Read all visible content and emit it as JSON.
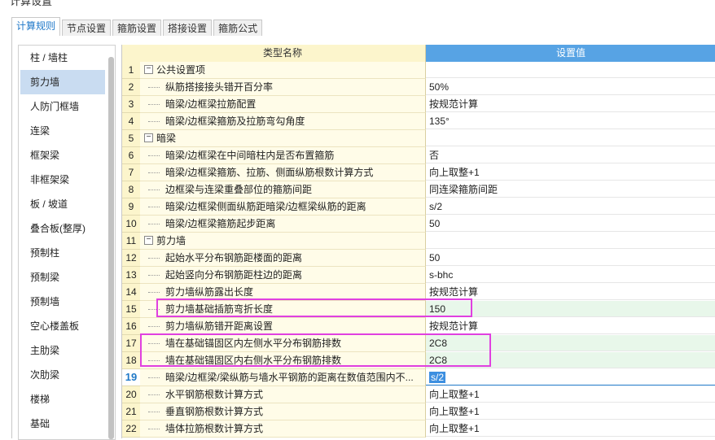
{
  "window": {
    "title": "计算设置"
  },
  "tabs": [
    {
      "label": "计算规则",
      "active": true
    },
    {
      "label": "节点设置",
      "active": false
    },
    {
      "label": "箍筋设置",
      "active": false
    },
    {
      "label": "搭接设置",
      "active": false
    },
    {
      "label": "箍筋公式",
      "active": false
    }
  ],
  "sidebar": {
    "items": [
      "柱 / 墙柱",
      "剪力墙",
      "人防门框墙",
      "连梁",
      "框架梁",
      "非框架梁",
      "板 / 坡道",
      "叠合板(整厚)",
      "预制柱",
      "预制梁",
      "预制墙",
      "空心楼盖板",
      "主肋梁",
      "次肋梁",
      "楼梯",
      "基础"
    ],
    "selected": "剪力墙"
  },
  "grid": {
    "header": {
      "name": "类型名称",
      "value": "设置值"
    },
    "selected_row": "19",
    "rows": [
      {
        "num": "1",
        "name": "公共设置项",
        "value": "",
        "group": true
      },
      {
        "num": "2",
        "name": "纵筋搭接接头错开百分率",
        "value": "50%"
      },
      {
        "num": "3",
        "name": "暗梁/边框梁拉筋配置",
        "value": "按规范计算"
      },
      {
        "num": "4",
        "name": "暗梁/边框梁箍筋及拉筋弯勾角度",
        "value": "135°"
      },
      {
        "num": "5",
        "name": "暗梁",
        "value": "",
        "group": true
      },
      {
        "num": "6",
        "name": "暗梁/边框梁在中间暗柱内是否布置箍筋",
        "value": "否"
      },
      {
        "num": "7",
        "name": "暗梁/边框梁箍筋、拉筋、侧面纵筋根数计算方式",
        "value": "向上取整+1"
      },
      {
        "num": "8",
        "name": "边框梁与连梁重叠部位的箍筋间距",
        "value": "同连梁箍筋间距"
      },
      {
        "num": "9",
        "name": "暗梁/边框梁侧面纵筋距暗梁/边框梁纵筋的距离",
        "value": "s/2"
      },
      {
        "num": "10",
        "name": "暗梁/边框梁箍筋起步距离",
        "value": "50"
      },
      {
        "num": "11",
        "name": "剪力墙",
        "value": "",
        "group": true
      },
      {
        "num": "12",
        "name": "起始水平分布钢筋距楼面的距离",
        "value": "50"
      },
      {
        "num": "13",
        "name": "起始竖向分布钢筋距柱边的距离",
        "value": "s-bhc"
      },
      {
        "num": "14",
        "name": "剪力墙纵筋露出长度",
        "value": "按规范计算"
      },
      {
        "num": "15",
        "name": "剪力墙基础插筋弯折长度",
        "value": "150",
        "green": true
      },
      {
        "num": "16",
        "name": "剪力墙纵筋错开距离设置",
        "value": "按规范计算"
      },
      {
        "num": "17",
        "name": "墙在基础锚固区内左侧水平分布钢筋排数",
        "value": "2C8",
        "green": true
      },
      {
        "num": "18",
        "name": "墙在基础锚固区内右侧水平分布钢筋排数",
        "value": "2C8",
        "green": true
      },
      {
        "num": "19",
        "name": "暗梁/边框梁/梁纵筋与墙水平钢筋的距离在数值范围内不...",
        "value": "s/2"
      },
      {
        "num": "20",
        "name": "水平钢筋根数计算方式",
        "value": "向上取整+1"
      },
      {
        "num": "21",
        "name": "垂直钢筋根数计算方式",
        "value": "向上取整+1"
      },
      {
        "num": "22",
        "name": "墙体拉筋根数计算方式",
        "value": "向上取整+1"
      }
    ]
  },
  "highlight_color": "#e040e0"
}
